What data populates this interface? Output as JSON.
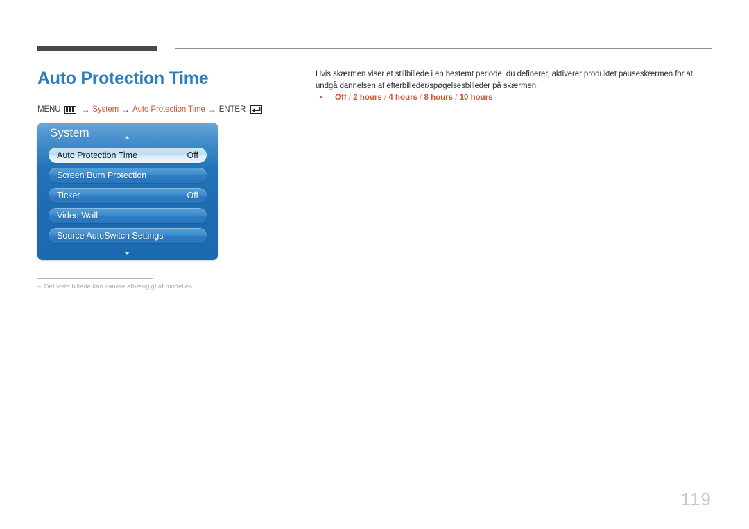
{
  "page": {
    "number": "119",
    "title": "Auto Protection Time"
  },
  "breadcrumb": {
    "menu_label": "MENU",
    "menu_icon": "menu-bars-icon",
    "arrow": "→",
    "path_1": "System",
    "path_2": "Auto Protection Time",
    "enter_label": "ENTER",
    "enter_icon": "enter-return-icon"
  },
  "osd": {
    "title": "System",
    "scroll_up_icon": "chevron-up-icon",
    "scroll_down_icon": "chevron-down-icon",
    "rows": [
      {
        "label": "Auto Protection Time",
        "value": "Off",
        "selected": true
      },
      {
        "label": "Screen Burn Protection",
        "value": "",
        "selected": false
      },
      {
        "label": "Ticker",
        "value": "Off",
        "selected": false
      },
      {
        "label": "Video Wall",
        "value": "",
        "selected": false
      },
      {
        "label": "Source AutoSwitch Settings",
        "value": "",
        "selected": false
      }
    ]
  },
  "footnote": {
    "dash": "–",
    "text": "Det viste billede kan variere afhængigt af modellen."
  },
  "description": {
    "paragraph": "Hvis skærmen viser et stillbillede i en bestemt periode, du definerer, aktiverer produktet pauseskærmen for at undgå dannelsen af efterbilleder/spøgelsesbilleder på skærmen.",
    "bullet_marker": "•",
    "options": [
      "Off",
      "2 hours",
      "4 hours",
      "8 hours",
      "10 hours"
    ],
    "options_separator": " / "
  },
  "colors": {
    "title_blue": "#2c7cc0",
    "accent_orange": "#d9532c",
    "rule_dark": "#474750",
    "osd_blue": "#1c6bb2",
    "page_number_gray": "#c9c6d2"
  }
}
